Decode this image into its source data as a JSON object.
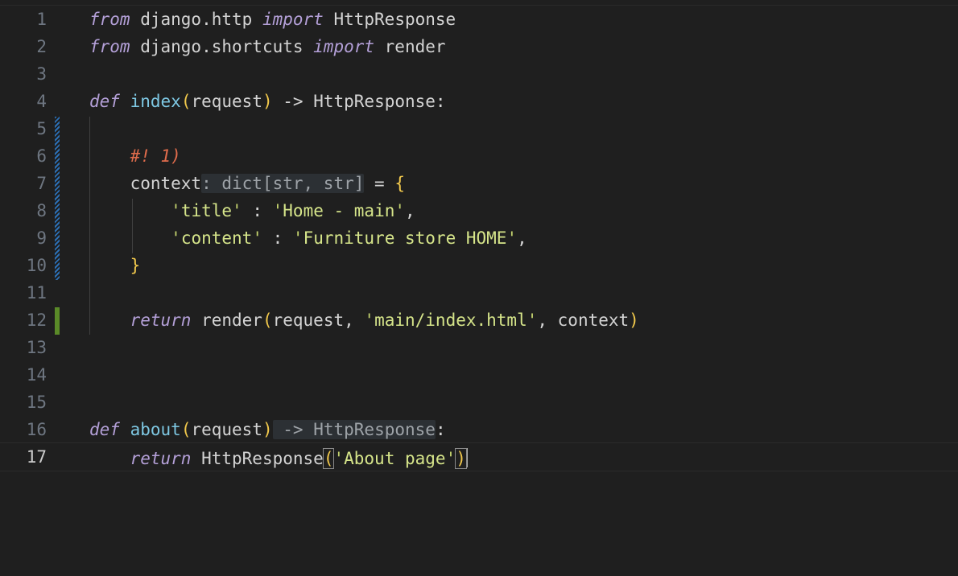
{
  "editor": {
    "lines": [
      {
        "n": "1"
      },
      {
        "n": "2"
      },
      {
        "n": "3"
      },
      {
        "n": "4"
      },
      {
        "n": "5"
      },
      {
        "n": "6"
      },
      {
        "n": "7"
      },
      {
        "n": "8"
      },
      {
        "n": "9"
      },
      {
        "n": "10"
      },
      {
        "n": "11"
      },
      {
        "n": "12"
      },
      {
        "n": "13"
      },
      {
        "n": "14"
      },
      {
        "n": "15"
      },
      {
        "n": "16"
      },
      {
        "n": "17"
      }
    ],
    "t": {
      "from": "from",
      "import": "import",
      "def": "def",
      "return": "return",
      "mod1": " django.http ",
      "cls1": " HttpResponse",
      "mod2": " django.shortcuts ",
      "render_plain": " render",
      "fn_index": "index",
      "fn_about": "about",
      "open_paren": "(",
      "close_paren": ")",
      "param": "request",
      "arrow_ret": " -> HttpResponse:",
      "comment": "#! 1)",
      "context": "context",
      "type_hint": ": dict[str, str]",
      "assign": " = ",
      "open_brace": "{",
      "close_brace": "}",
      "q": "'",
      "key_title": "title",
      "val_title": "Home - main",
      "key_content": "content",
      "val_content": "Furniture store HOME",
      "colon_sep": " : ",
      "comma": ",",
      "render_call": " render",
      "request_comma": "request, ",
      "template": "main/index.html",
      "comma_context": ", context",
      "about_arrow": " -> HttpResponse",
      "colon": ":",
      "http_response": " HttpResponse",
      "about_page": "About page"
    }
  },
  "colors": {
    "background": "#1f1f1f",
    "keyword": "#b4a0d8",
    "function": "#7ec8e3",
    "string": "#d6e58a",
    "comment": "#e06c4c",
    "bracket": "#f2c94c",
    "git_modified": "#2b6fb5",
    "git_added": "#5a8a28"
  }
}
